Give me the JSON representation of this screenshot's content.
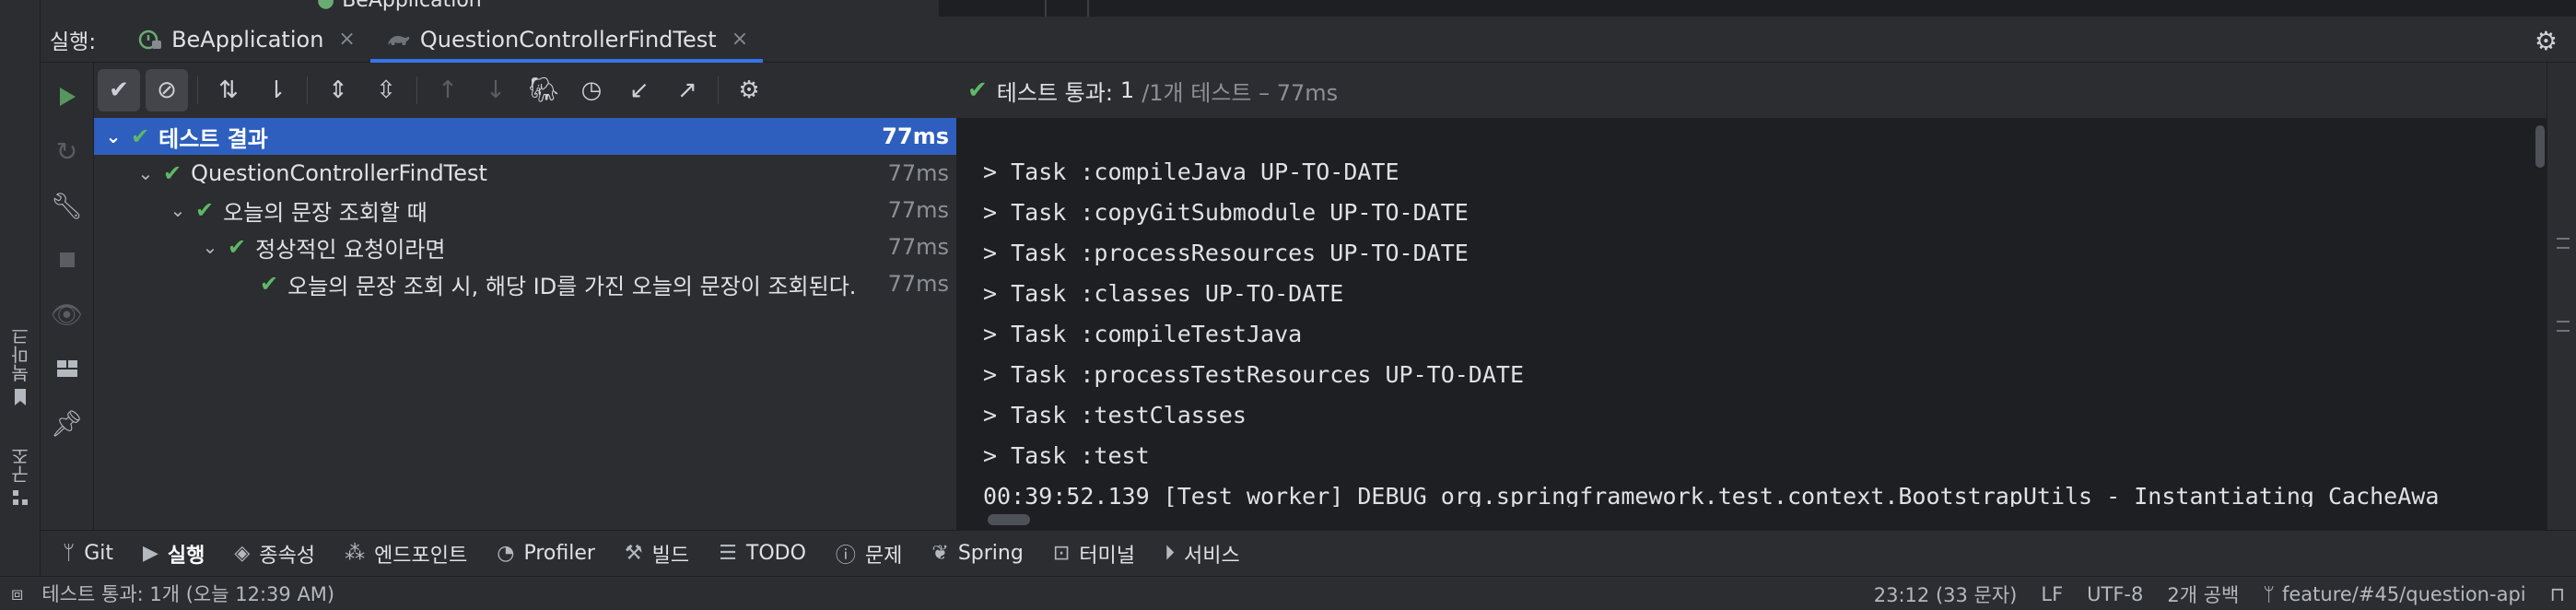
{
  "top_remnant": {
    "text": "BeApplication"
  },
  "run_header": {
    "label": "실행:",
    "tabs": [
      {
        "label": "BeApplication",
        "active": false
      },
      {
        "label": "QuestionControllerFindTest",
        "active": true
      }
    ],
    "close_glyph": "×"
  },
  "left_strip": {
    "bookmarks_label": "북마크",
    "structure_label": "구조"
  },
  "test_status": {
    "passed_label": "테스트 통과:",
    "passed_count": "1",
    "detail": "/1개 테스트 – 77ms"
  },
  "tree": {
    "rows": [
      {
        "label": "테스트 결과",
        "duration": "77ms",
        "level": 0,
        "selected": true
      },
      {
        "label": "QuestionControllerFindTest",
        "duration": "77ms",
        "level": 1,
        "selected": false
      },
      {
        "label": "오늘의 문장 조회할 때",
        "duration": "77ms",
        "level": 2,
        "selected": false
      },
      {
        "label": "정상적인 요청이라면",
        "duration": "77ms",
        "level": 3,
        "selected": false
      },
      {
        "label": "오늘의 문장 조회 시, 해당 ID를 가진 오늘의 문장이 조회된다.",
        "duration": "77ms",
        "level": 4,
        "selected": false
      }
    ]
  },
  "console": {
    "lines": [
      "> Task :compileJava UP-TO-DATE",
      "> Task :copyGitSubmodule UP-TO-DATE",
      "> Task :processResources UP-TO-DATE",
      "> Task :classes UP-TO-DATE",
      "> Task :compileTestJava",
      "> Task :processTestResources UP-TO-DATE",
      "> Task :testClasses",
      "> Task :test",
      "00:39:52.139 [Test worker] DEBUG org.springframework.test.context.BootstrapUtils - Instantiating CacheAwa"
    ]
  },
  "tool_windows": [
    {
      "label": "Git",
      "icon": "git-branch-icon",
      "active": false
    },
    {
      "label": "실행",
      "icon": "run-icon",
      "active": true
    },
    {
      "label": "종속성",
      "icon": "dependencies-icon",
      "active": false
    },
    {
      "label": "엔드포인트",
      "icon": "endpoints-icon",
      "active": false
    },
    {
      "label": "Profiler",
      "icon": "profiler-icon",
      "active": false
    },
    {
      "label": "빌드",
      "icon": "build-icon",
      "active": false
    },
    {
      "label": "TODO",
      "icon": "todo-icon",
      "active": false
    },
    {
      "label": "문제",
      "icon": "problems-icon",
      "active": false
    },
    {
      "label": "Spring",
      "icon": "spring-icon",
      "active": false
    },
    {
      "label": "터미널",
      "icon": "terminal-icon",
      "active": false
    },
    {
      "label": "서비스",
      "icon": "services-icon",
      "active": false
    }
  ],
  "status_bar": {
    "message": "테스트 통과: 1개 (오늘 12:39 AM)",
    "position": "23:12 (33 문자)",
    "line_separator": "LF",
    "encoding": "UTF-8",
    "indent": "2개 공백",
    "branch": "feature/#45/question-api"
  },
  "colors": {
    "accent": "#3574f0",
    "selection": "#2e5fbf",
    "success": "#5fb865",
    "run_green": "#57965c"
  }
}
